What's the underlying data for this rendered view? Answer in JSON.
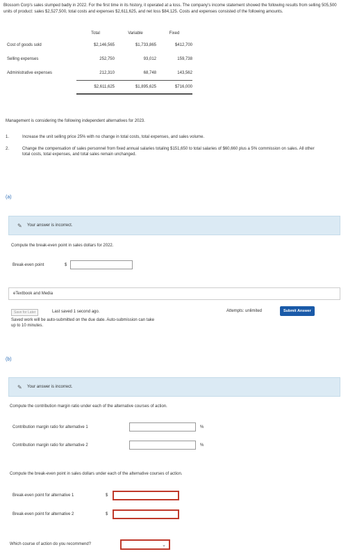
{
  "intro": "Blossom Corp's sales slumped badly in 2022. For the first time in its history, it operated at a loss. The company's income statement showed the following results from selling 505,500 units of product: sales $2,527,500, total costs and expenses $2,611,625, and net loss $84,125. Costs and expenses consisted of the following amounts.",
  "table": {
    "headers": [
      "Total",
      "Variable",
      "Fixed"
    ],
    "rows": [
      {
        "label": "Cost of goods sold",
        "total": "$2,146,565",
        "variable": "$1,733,865",
        "fixed": "$412,700"
      },
      {
        "label": "Selling expenses",
        "total": "252,750",
        "variable": "93,012",
        "fixed": "159,738"
      },
      {
        "label": "Administrative expenses",
        "total": "212,310",
        "variable": "68,748",
        "fixed": "143,562"
      }
    ],
    "totals": {
      "total": "$2,611,625",
      "variable": "$1,895,625",
      "fixed": "$716,000"
    }
  },
  "mgmt": "Management is considering the following independent alternatives for 2023.",
  "alternatives": [
    {
      "num": "1.",
      "text": "Increase the unit selling price 25% with no change in total costs, total expenses, and sales volume."
    },
    {
      "num": "2.",
      "text": "Change the compensation of sales personnel from fixed annual salaries totaling $151,650 to total salaries of $60,660 plus a 5% commission on sales. All other total costs, total expenses, and total sales remain unchanged."
    }
  ],
  "part_a": {
    "label": "(a)",
    "banner": "Your answer is incorrect.",
    "question": "Compute the break-even point in sales dollars for 2022.",
    "field_label": "Break-even point",
    "currency": "$",
    "value": ""
  },
  "etextbook": "eTextbook and Media",
  "save_label": "Save for Later",
  "last_saved": "Last saved 1 second ago.",
  "auto_submit": "Saved work will be auto-submitted on the due date. Auto-submission can take up to 10 minutes.",
  "attempts": "Attempts: unlimited",
  "submit_label": "Submit Answer",
  "part_b": {
    "label": "(b)",
    "banner": "Your answer is incorrect.",
    "question1": "Compute the contribution margin ratio under each of the alternative courses of action.",
    "cm1_label": "Contribution margin ratio for alternative 1",
    "cm2_label": "Contribution margin ratio for alternative 2",
    "pct": "%",
    "question2": "Compute the break-even point in sales dollars under each of the alternative courses of action.",
    "be1_label": "Break-even point for alternative 1",
    "be2_label": "Break-even point for alternative 2",
    "currency": "$",
    "recommend_label": "Which course of action do you recommend?"
  },
  "colors": {
    "banner_bg": "#dbeaf4",
    "error": "#c0392b",
    "submit": "#1a5aa8",
    "part_label": "#2a6db8"
  }
}
